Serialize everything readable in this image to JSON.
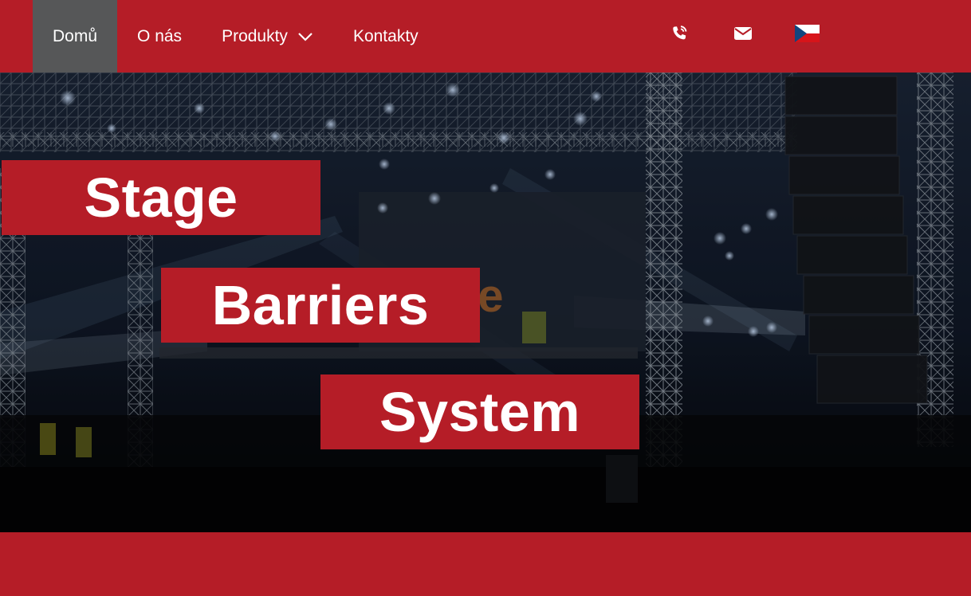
{
  "nav": {
    "items": [
      {
        "label": "Domů",
        "active": true
      },
      {
        "label": "O nás",
        "active": false
      },
      {
        "label": "Produkty",
        "active": false,
        "has_dropdown": true
      },
      {
        "label": "Kontakty",
        "active": false
      }
    ],
    "icons": [
      "phone-icon",
      "mail-icon",
      "czech-flag-icon"
    ]
  },
  "hero": {
    "lines": [
      "Stage",
      "Barriers",
      "System"
    ],
    "background_sign": "stage"
  },
  "colors": {
    "brand_red": "#b51d27",
    "nav_active": "#565758",
    "text": "#ffffff"
  }
}
